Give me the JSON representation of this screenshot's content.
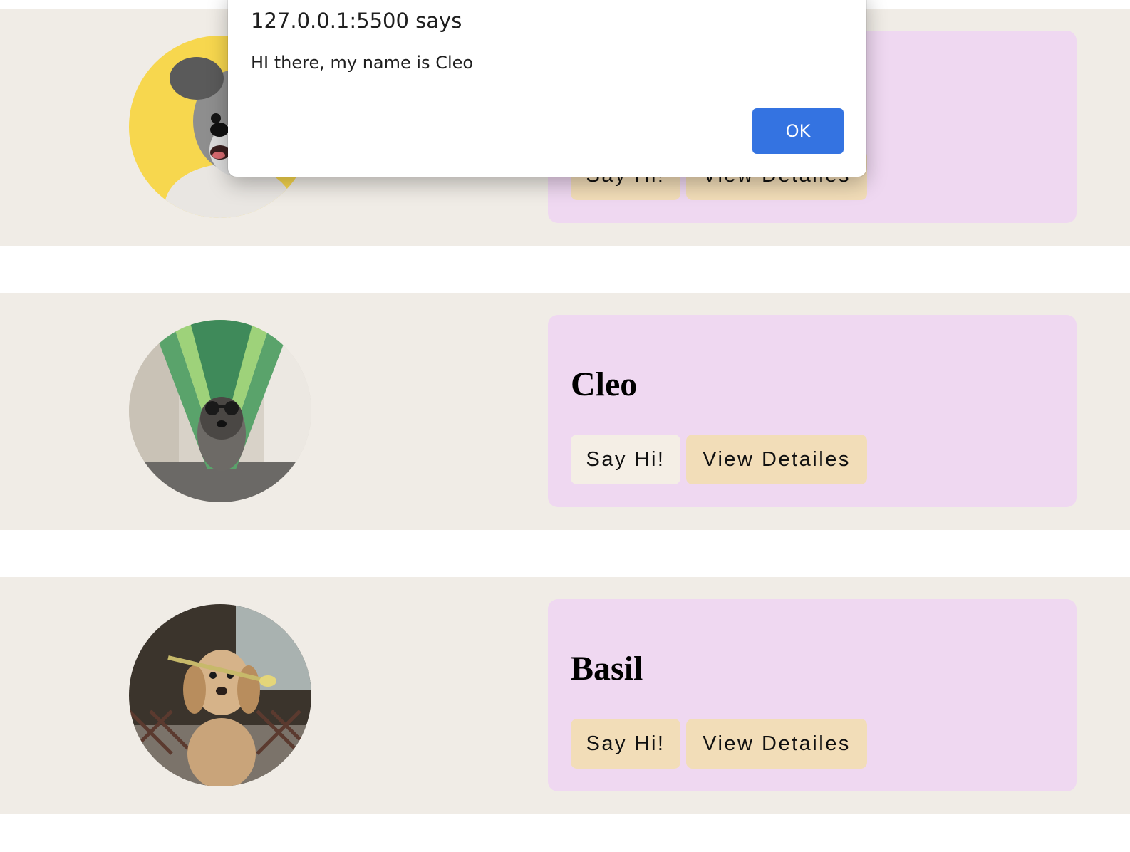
{
  "alert": {
    "title": "127.0.0.1:5500 says",
    "message": "HI there, my name is Cleo",
    "ok_label": "OK"
  },
  "pets": [
    {
      "name": "",
      "say_hi_label": "Say Hi!",
      "details_label": "View Detailes",
      "photo_description": "schnauzer-on-yellow"
    },
    {
      "name": "Cleo",
      "say_hi_label": "Say Hi!",
      "details_label": "View Detailes",
      "photo_description": "dog-with-sunglasses-in-hammock"
    },
    {
      "name": "Basil",
      "say_hi_label": "Say Hi!",
      "details_label": "View Detailes",
      "photo_description": "golden-retriever-with-flower"
    }
  ],
  "colors": {
    "row_background": "#f0ece6",
    "card_background": "#efd8f1",
    "button_background": "#f2ddb8",
    "button_active_background": "#f4eee5",
    "alert_ok": "#3473e1"
  }
}
